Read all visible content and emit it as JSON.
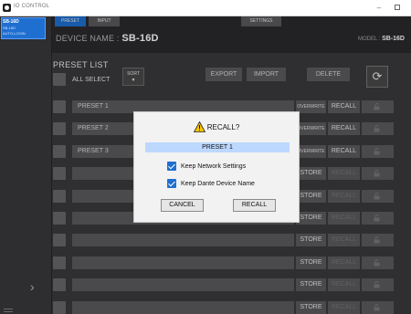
{
  "window": {
    "title": "IO CONTROL",
    "minimize_glyph": "–"
  },
  "device_panel": {
    "device": {
      "name": "SB-16D",
      "line2": "SB-16D",
      "line3": "AUTO-LOGIN"
    },
    "expand_glyph": "›"
  },
  "tabs": {
    "preset": "PRESET",
    "input": "INPUT",
    "settings": "SETTINGS"
  },
  "header": {
    "device_name_label": "DEVICE NAME : ",
    "device_name": "SB-16D",
    "model_label": "MODEL : ",
    "model": "SB-16D"
  },
  "preset_list": {
    "title": "PRESET LIST",
    "all_select": "ALL SELECT",
    "sort_label": "SORT",
    "sort_glyph": "▼",
    "export": "EXPORT",
    "import": "IMPORT",
    "delete": "DELETE",
    "reload_glyph": "⟳",
    "overwrite": "OVERWRITE",
    "store": "STORE",
    "recall": "RECALL",
    "rows": [
      {
        "name": "PRESET 1"
      },
      {
        "name": "PRESET 2"
      },
      {
        "name": "PRESET 3"
      },
      {
        "name": ""
      },
      {
        "name": ""
      },
      {
        "name": ""
      },
      {
        "name": ""
      },
      {
        "name": ""
      },
      {
        "name": ""
      },
      {
        "name": ""
      }
    ]
  },
  "dialog": {
    "title": "RECALL?",
    "preset_name": "PRESET 1",
    "option1": "Keep Network Settings",
    "option2": "Keep Dante Device Name",
    "cancel": "CANCEL",
    "recall": "RECALL"
  },
  "icons": {
    "warning": "warning-icon",
    "checkbox": "check-icon",
    "reload": "reload-icon",
    "lock": "lock-icon"
  },
  "colors": {
    "accent": "#1f6fd1",
    "panel": "#3a3a3c",
    "dialog_bg": "#f2f2f2",
    "selected_preset": "#bcd8ff"
  }
}
